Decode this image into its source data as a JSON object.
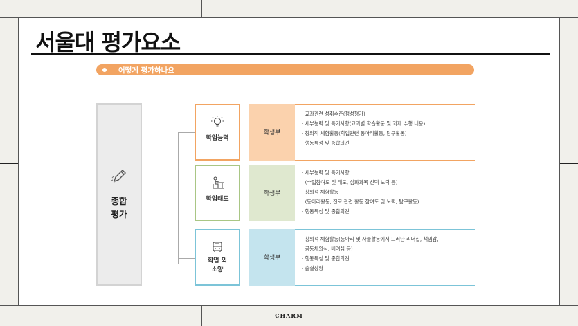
{
  "title": "서울대 평가요소",
  "section_label": "어떻게 평가하나요",
  "overall": {
    "line1": "종합",
    "line2": "평가"
  },
  "categories": [
    {
      "label_lines": [
        "학업능력"
      ],
      "source": "학생부",
      "border_color": "#f2a462",
      "fill_color": "#fbd2ad",
      "items": [
        "· 교과관련 성취수준(정성평가)",
        "· 세부능력 및 특기사항(교과별 학습활동 및 과제 수행 내용)",
        "· 창의적 체험활동(학업관련 동아리활동, 탐구활동)",
        "· 행동특성 및 종합의견"
      ]
    },
    {
      "label_lines": [
        "학업태도"
      ],
      "source": "학생부",
      "border_color": "#a9c685",
      "fill_color": "#dfe8cf",
      "items": [
        "· 세부능력 및 특기사항",
        "  (수업참여도 및 태도, 심화과목 선택 노력 등)",
        "· 창의적 체험활동",
        "  (동아리활동, 진로 관련 활동 참여도 및 노력, 탐구활동)",
        "· 행동특성 및 종합의견"
      ]
    },
    {
      "label_lines": [
        "학업 외",
        "소양"
      ],
      "source": "학생부",
      "border_color": "#7cc4d8",
      "fill_color": "#c4e4ee",
      "items": [
        "· 창의적 체험활동(동아리 및 자율활동에서 드러난 리더십, 책임감,",
        "  공동체의식, 배려심 등)",
        "· 행동특성 및 종합의견",
        "· 출결상황"
      ]
    }
  ],
  "footer": "CHARM"
}
